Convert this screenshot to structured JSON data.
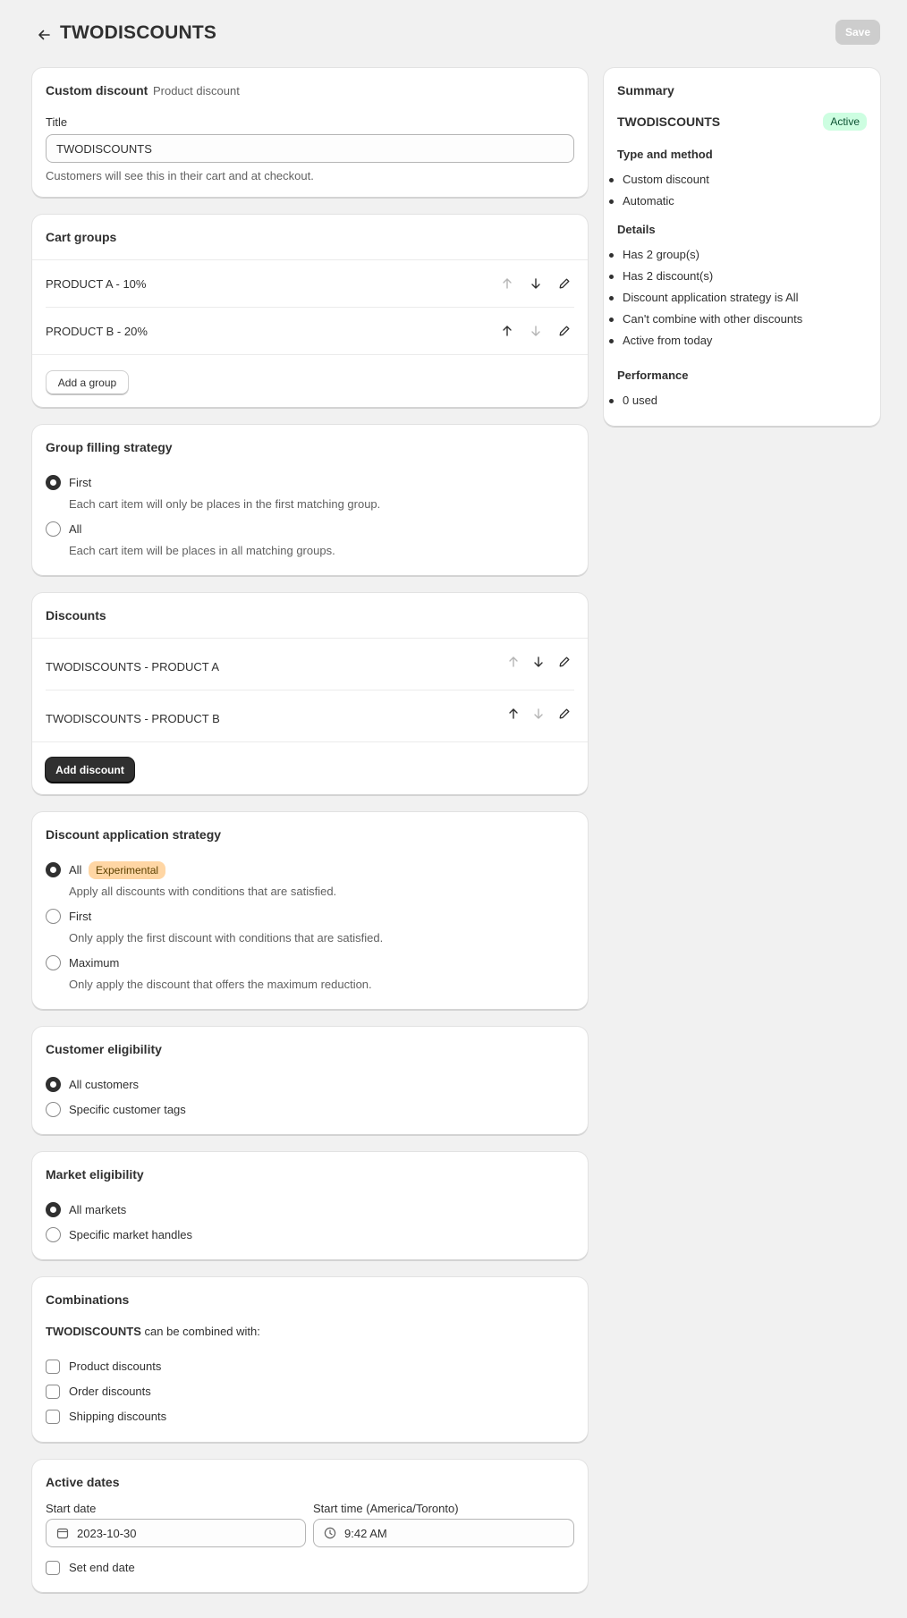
{
  "header": {
    "title": "TWODISCOUNTS",
    "save_label": "Save"
  },
  "custom_discount": {
    "title": "Custom discount",
    "subtitle": "Product discount",
    "field_label": "Title",
    "field_value": "TWODISCOUNTS",
    "help": "Customers will see this in their cart and at checkout."
  },
  "cart_groups": {
    "title": "Cart groups",
    "items": [
      {
        "label": "PRODUCT A - 10%"
      },
      {
        "label": "PRODUCT B - 20%"
      }
    ],
    "add_label": "Add a group"
  },
  "group_filling": {
    "title": "Group filling strategy",
    "options": [
      {
        "label": "First",
        "help": "Each cart item will only be places in the first matching group.",
        "selected": true
      },
      {
        "label": "All",
        "help": "Each cart item will be places in all matching groups.",
        "selected": false
      }
    ]
  },
  "discounts": {
    "title": "Discounts",
    "items": [
      {
        "label": "TWODISCOUNTS - PRODUCT A"
      },
      {
        "label": "TWODISCOUNTS - PRODUCT B"
      }
    ],
    "add_label": "Add discount"
  },
  "application_strategy": {
    "title": "Discount application strategy",
    "badge": "Experimental",
    "options": [
      {
        "label": "All",
        "help": "Apply all discounts with conditions that are satisfied.",
        "selected": true
      },
      {
        "label": "First",
        "help": "Only apply the first discount with conditions that are satisfied.",
        "selected": false
      },
      {
        "label": "Maximum",
        "help": "Only apply the discount that offers the maximum reduction.",
        "selected": false
      }
    ]
  },
  "customer_eligibility": {
    "title": "Customer eligibility",
    "options": [
      {
        "label": "All customers",
        "selected": true
      },
      {
        "label": "Specific customer tags",
        "selected": false
      }
    ]
  },
  "market_eligibility": {
    "title": "Market eligibility",
    "options": [
      {
        "label": "All markets",
        "selected": true
      },
      {
        "label": "Specific market handles",
        "selected": false
      }
    ]
  },
  "combinations": {
    "title": "Combinations",
    "code": "TWODISCOUNTS",
    "intro": "can be combined with:",
    "options": [
      {
        "label": "Product discounts",
        "checked": false
      },
      {
        "label": "Order discounts",
        "checked": false
      },
      {
        "label": "Shipping discounts",
        "checked": false
      }
    ]
  },
  "active_dates": {
    "title": "Active dates",
    "start_date_label": "Start date",
    "start_date": "2023-10-30",
    "start_time_label": "Start time (America/Toronto)",
    "start_time": "9:42 AM",
    "end_date_label": "Set end date"
  },
  "summary": {
    "title": "Summary",
    "code": "TWODISCOUNTS",
    "status": "Active",
    "type_heading": "Type and method",
    "type_items": [
      "Custom discount",
      "Automatic"
    ],
    "details_heading": "Details",
    "details_items": [
      "Has 2 group(s)",
      "Has 2 discount(s)",
      "Discount application strategy is All",
      "Can't combine with other discounts",
      "Active from today"
    ],
    "performance_heading": "Performance",
    "performance_items": [
      "0 used"
    ]
  },
  "colors": {
    "background": "#f1f1f1",
    "primary_button": "#303030",
    "experimental_badge": "#ffd6a4",
    "active_badge": "#cdfee1"
  }
}
